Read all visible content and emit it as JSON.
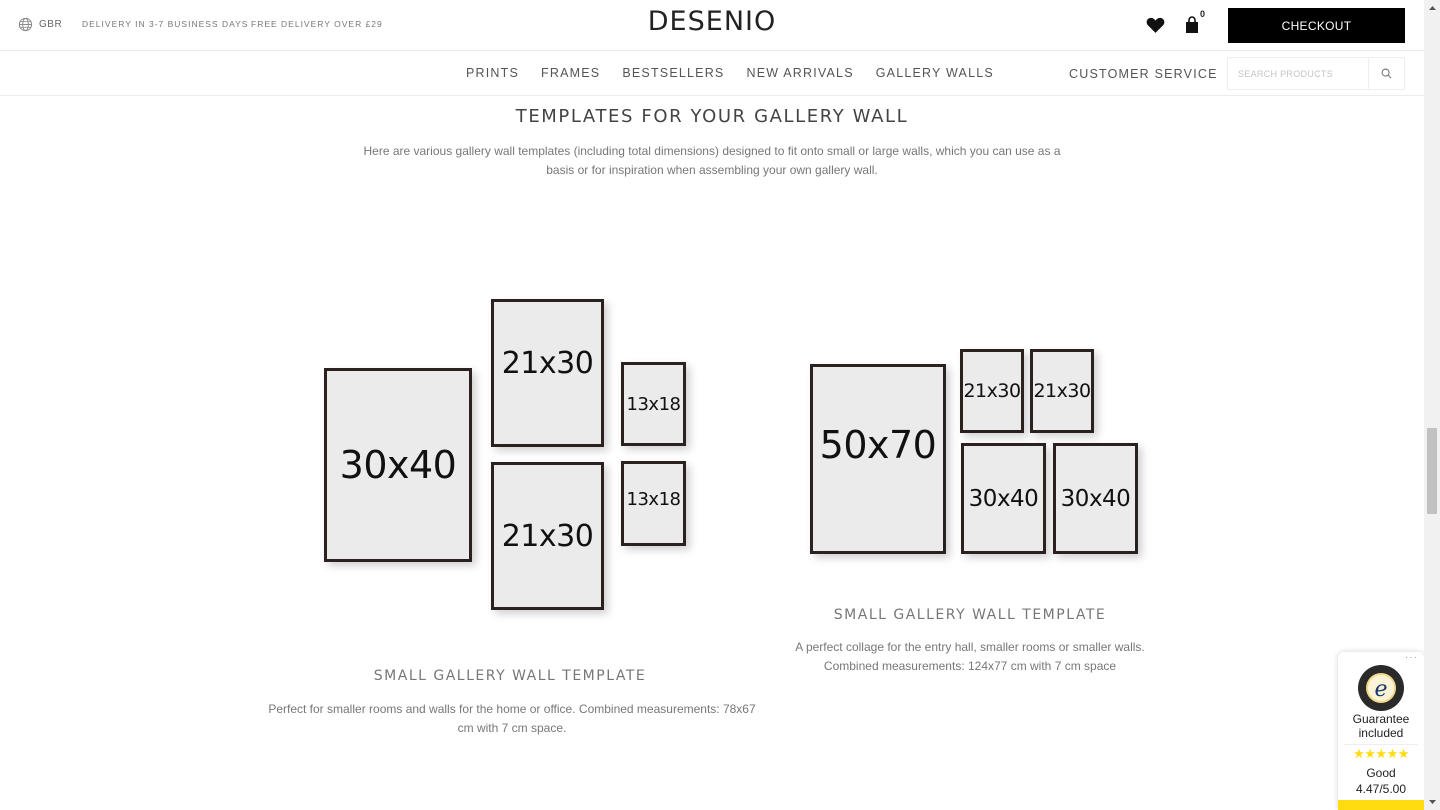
{
  "topbar": {
    "country_code": "GBR",
    "delivery_time": "DELIVERY IN 3-7 BUSINESS DAYS",
    "free_delivery": "FREE DELIVERY OVER £29",
    "logo": "DESENIO",
    "cart_count": "0",
    "checkout_label": "CHECKOUT"
  },
  "nav": {
    "links": [
      "PRINTS",
      "FRAMES",
      "BESTSELLERS",
      "NEW ARRIVALS",
      "GALLERY WALLS"
    ],
    "customer_service": "CUSTOMER SERVICE",
    "search_placeholder": "SEARCH PRODUCTS"
  },
  "content": {
    "heading": "TEMPLATES FOR YOUR GALLERY WALL",
    "intro": "Here are various gallery wall templates (including total dimensions) designed to fit onto small or large walls, which you can use as a basis or for inspiration when assembling your own gallery wall.",
    "templates": [
      {
        "title": "SMALL GALLERY WALL TEMPLATE",
        "description": "Perfect for smaller rooms and walls for the home or office. Combined measurements: 78x67 cm with 7 cm space.",
        "frames": [
          "30x40",
          "21x30",
          "21x30",
          "13x18",
          "13x18"
        ]
      },
      {
        "title": "SMALL GALLERY WALL TEMPLATE",
        "description": "A perfect collage for the entry hall, smaller rooms or smaller walls. Combined measurements: 124x77 cm with 7 cm space",
        "frames": [
          "50x70",
          "21x30",
          "21x30",
          "30x40",
          "30x40"
        ]
      }
    ]
  },
  "trusted_shops": {
    "guarantee": "Guarantee included",
    "stars": "★★★★★",
    "rating_word": "Good",
    "rating_value": "4.47/5.00",
    "menu": "···"
  },
  "colors": {
    "accent_yellow": "#ffdc0f",
    "checkout_bg": "#000000",
    "frame_border": "#2b2120"
  }
}
